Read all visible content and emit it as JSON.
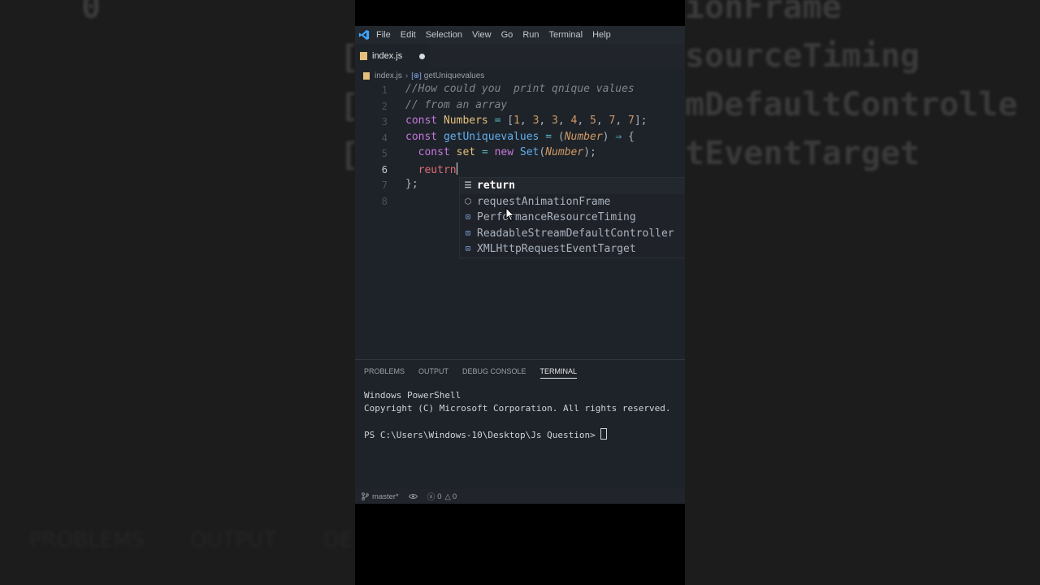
{
  "menu": {
    "items": [
      "File",
      "Edit",
      "Selection",
      "View",
      "Go",
      "Run",
      "Terminal",
      "Help"
    ]
  },
  "tab": {
    "label": "index.js"
  },
  "breadcrumb": {
    "file": "index.js",
    "symbol": "getUniquevalues"
  },
  "editor": {
    "line_numbers": [
      "1",
      "2",
      "3",
      "4",
      "5",
      "6",
      "7",
      "8"
    ],
    "active_line": "6",
    "lines": [
      "//How could you  print qnique values",
      "// from an array",
      "const Numbers = [1, 3, 3, 4, 5, 7, 7];",
      "const getUniquevalues = (Number) ⇒ {",
      "  const set = new Set(Number);",
      "  reutrn",
      "};",
      ""
    ]
  },
  "suggestions": [
    {
      "label": "return",
      "icon": "keyword-icon",
      "selected": true
    },
    {
      "label": "requestAnimationFrame",
      "icon": "function-icon",
      "selected": false
    },
    {
      "label": "PerformanceResourceTiming",
      "icon": "variable-icon",
      "selected": false
    },
    {
      "label": "ReadableStreamDefaultController",
      "icon": "variable-icon",
      "selected": false
    },
    {
      "label": "XMLHttpRequestEventTarget",
      "icon": "variable-icon",
      "selected": false
    }
  ],
  "panel": {
    "tabs": [
      "PROBLEMS",
      "OUTPUT",
      "DEBUG CONSOLE",
      "TERMINAL"
    ],
    "active_tab": "TERMINAL",
    "terminal": {
      "line1": "Windows PowerShell",
      "line2": "Copyright (C) Microsoft Corporation. All rights reserved.",
      "prompt": "PS C:\\Users\\Windows-10\\Desktop\\Js Question> "
    }
  },
  "statusbar": {
    "branch": "master*",
    "errors": "0",
    "warnings": "0"
  },
  "background_left": {
    "text_lines": [
      "0",
      "[e",
      "[e",
      "[e"
    ],
    "bottom_tabs": [
      "PROBLEMS",
      "OUTPUT",
      "DE"
    ]
  },
  "background_right": {
    "text_lines": [
      "ionFrame",
      "sourceTiming",
      "mDefaultControlle",
      "tEventTarget"
    ]
  },
  "colors": {
    "editor_bg": "#1e2329",
    "keyword": "#c678dd",
    "function": "#61afef",
    "variable": "#e5c07b",
    "number": "#d19a66",
    "comment": "#7f848e"
  }
}
